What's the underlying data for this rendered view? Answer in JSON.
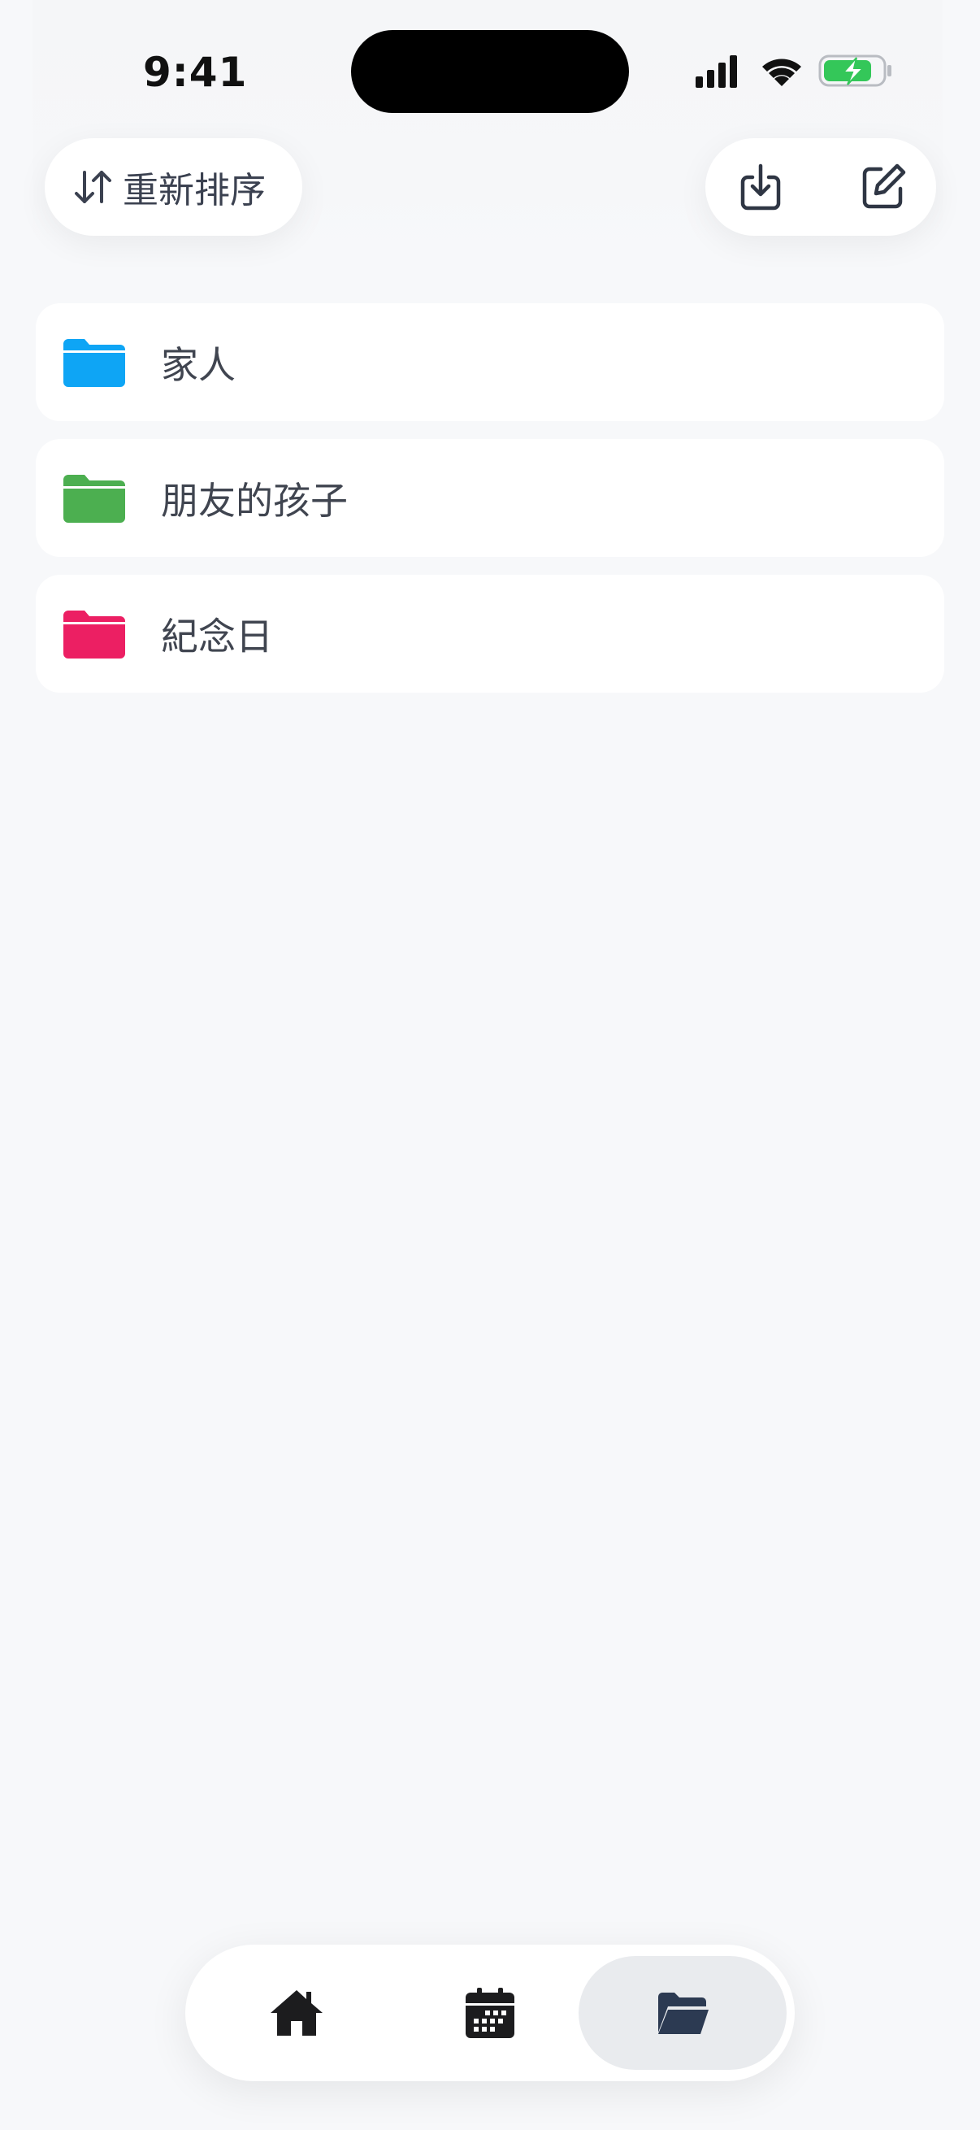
{
  "status_bar": {
    "time": "9:41"
  },
  "toolbar": {
    "reorder_label": "重新排序",
    "reorder_icon": "sort-arrows-icon",
    "import_icon": "import-tray-icon",
    "edit_icon": "compose-icon"
  },
  "folders": [
    {
      "label": "家人",
      "color": "#0ea5f5",
      "icon": "folder-icon"
    },
    {
      "label": "朋友的孩子",
      "color": "#4caf50",
      "icon": "folder-icon"
    },
    {
      "label": "紀念日",
      "color": "#ec1f63",
      "icon": "folder-icon"
    }
  ],
  "tab_bar": {
    "tabs": [
      {
        "icon": "home-icon",
        "selected": false
      },
      {
        "icon": "calendar-icon",
        "selected": false
      },
      {
        "icon": "folder-open-icon",
        "selected": true
      }
    ],
    "active_color": "#2c3a52",
    "inactive_color": "#1c1c1e"
  }
}
